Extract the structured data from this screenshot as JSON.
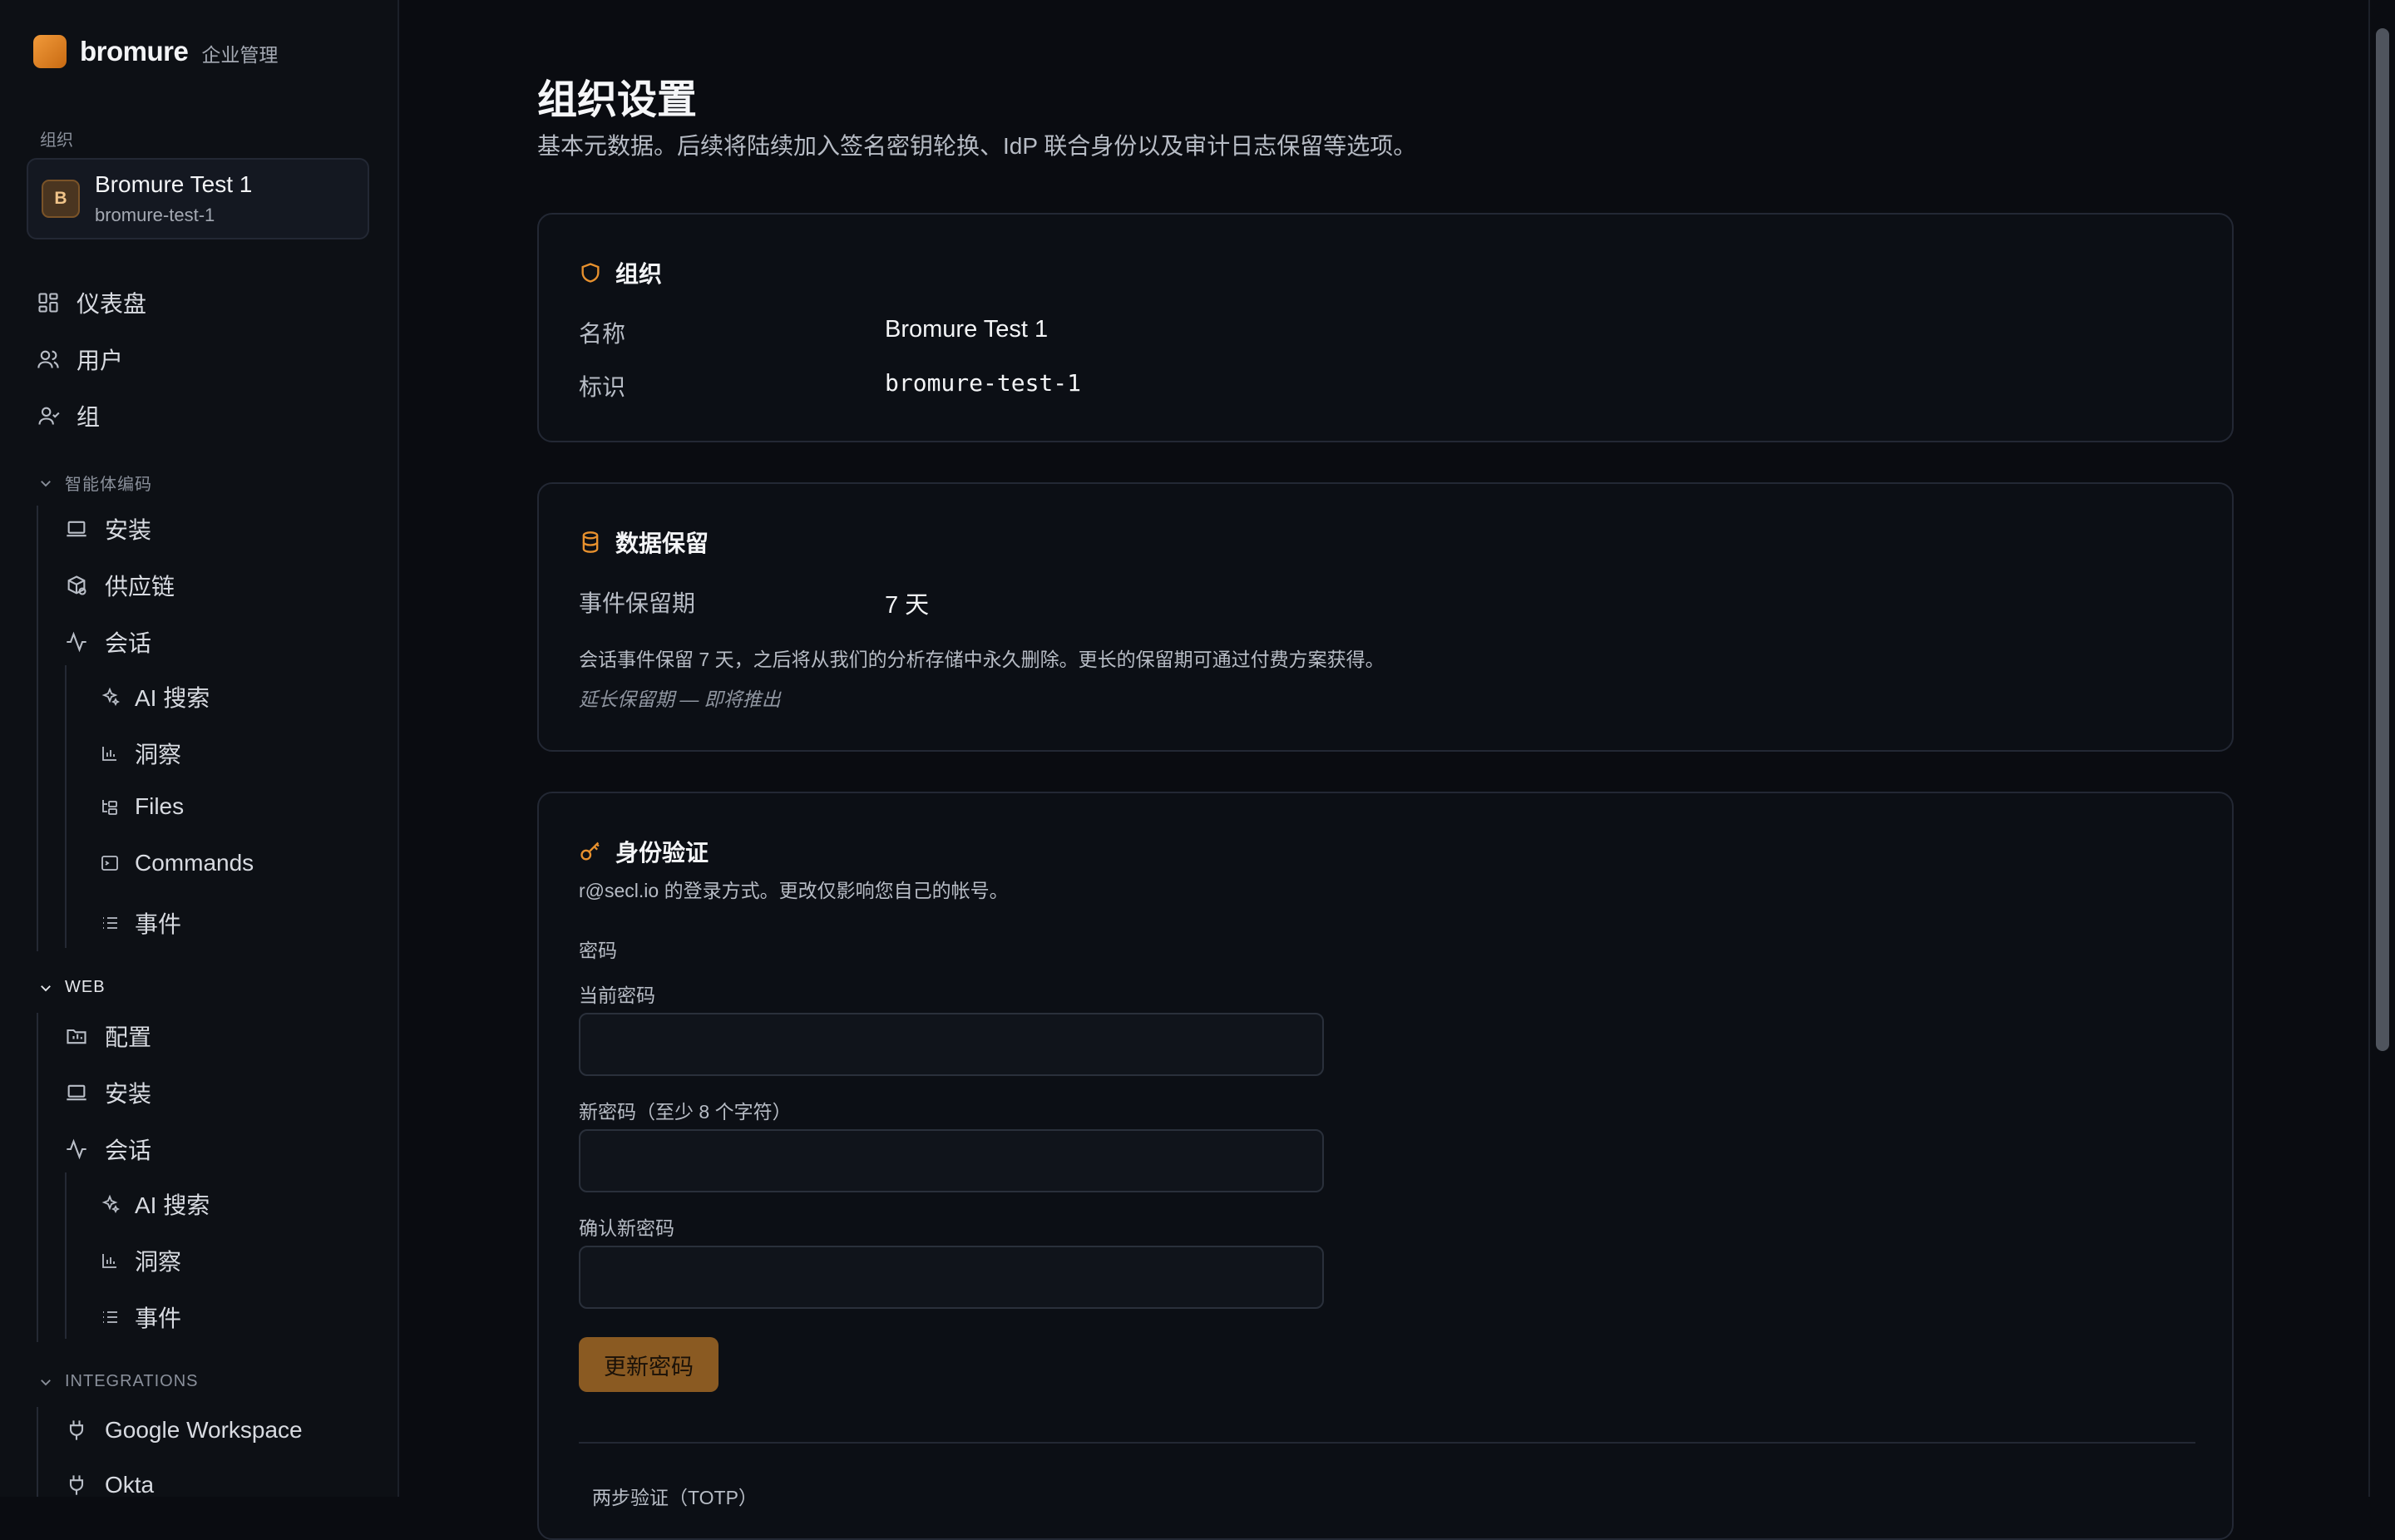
{
  "brand": {
    "name": "bromure",
    "subtitle": "企业管理"
  },
  "org_section_label": "组织",
  "org": {
    "initial": "B",
    "name": "Bromure Test 1",
    "slug": "bromure-test-1"
  },
  "nav": {
    "dashboard": "仪表盘",
    "users": "用户",
    "groups": "组"
  },
  "agent_section": {
    "title": "智能体编码",
    "install": "安装",
    "supply_chain": "供应链",
    "sessions": "会话",
    "ai_search": "AI 搜索",
    "insights": "洞察",
    "files": "Files",
    "commands": "Commands",
    "events": "事件"
  },
  "web_section": {
    "title": "WEB",
    "config": "配置",
    "install": "安装",
    "sessions": "会话",
    "ai_search": "AI 搜索",
    "insights": "洞察",
    "events": "事件"
  },
  "integrations_section": {
    "title": "INTEGRATIONS",
    "google": "Google Workspace",
    "okta": "Okta"
  },
  "page": {
    "title": "组织设置",
    "subtitle": "基本元数据。后续将陆续加入签名密钥轮换、IdP 联合身份以及审计日志保留等选项。"
  },
  "org_card": {
    "title": "组织",
    "name_label": "名称",
    "name_value": "Bromure Test 1",
    "id_label": "标识",
    "id_value": "bromure-test-1"
  },
  "retention_card": {
    "title": "数据保留",
    "period_label": "事件保留期",
    "period_value": "7 天",
    "description": "会话事件保留 7 天，之后将从我们的分析存储中永久删除。更长的保留期可通过付费方案获得。",
    "coming_soon": "延长保留期 — 即将推出"
  },
  "auth_card": {
    "title": "身份验证",
    "subtitle": "r@secl.io 的登录方式。更改仅影响您自己的帐号。",
    "password_heading": "密码",
    "current_label": "当前密码",
    "new_label": "新密码（至少 8 个字符）",
    "confirm_label": "确认新密码",
    "current_value": "",
    "new_value": "",
    "confirm_value": "",
    "update_button": "更新密码",
    "totp_label": "两步验证（TOTP）"
  },
  "colors": {
    "accent": "#e8912e",
    "button": "#8a5a22",
    "background": "#0a0c11"
  }
}
